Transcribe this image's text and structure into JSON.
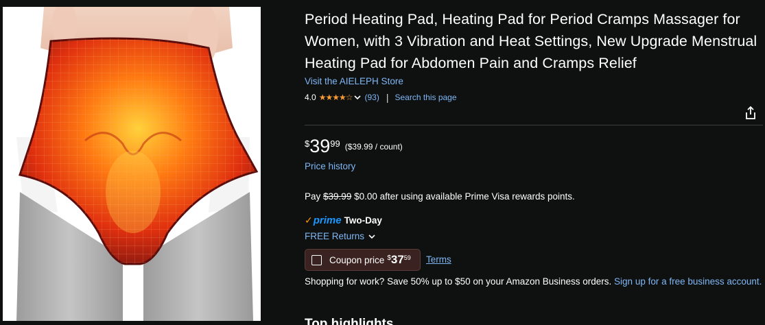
{
  "product": {
    "title": "Period Heating Pad, Heating Pad for Period Cramps Massager for Women, with 3 Vibration and Heat Settings, New Upgrade Menstrual Heating Pad for Abdomen Pain and Cramps Relief",
    "store_link": "Visit the AIELEPH Store",
    "image_alt": "Period heating pad worn on abdomen"
  },
  "rating": {
    "value": "4.0",
    "stars": "★★★★☆",
    "count": "(93)",
    "separator": "|",
    "search_link": "Search this page"
  },
  "price": {
    "symbol": "$",
    "whole": "39",
    "fraction": "99",
    "unit_price": "($39.99 / count)",
    "history_link": "Price history"
  },
  "pay_offer": {
    "prefix": "Pay",
    "strike_price": "$39.99",
    "suffix": "$0.00 after using available Prime Visa rewards points."
  },
  "delivery": {
    "prime_check": "✓",
    "prime_word": "prime",
    "speed": "Two-Day",
    "returns": "FREE Returns"
  },
  "coupon": {
    "label": "Coupon price",
    "symbol": "$",
    "whole": "37",
    "fraction": "59",
    "terms": "Terms"
  },
  "business": {
    "text": "Shopping for work? Save 50% up to $50 on your Amazon Business orders.",
    "link": "Sign up for a free business account."
  },
  "section": {
    "highlights": "Top highlights"
  },
  "colors": {
    "background": "#0f1111",
    "link": "#7fb7f5",
    "star": "#f79b35",
    "prime_blue": "#1a98ff",
    "prime_check": "#ff9900",
    "coupon_bg": "#3a2220"
  },
  "icons": {
    "share": "share-icon",
    "chevron": "chevron-down-icon",
    "checkbox": "checkbox-icon"
  }
}
